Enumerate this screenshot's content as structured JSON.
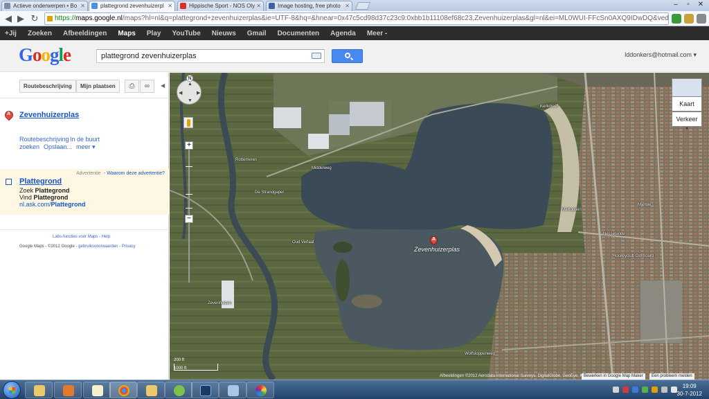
{
  "browser": {
    "tabs": [
      {
        "title": "Actieve onderwerpen • Bo",
        "favicon_color": "#7a8fa8"
      },
      {
        "title": "plattegrond zevenhuizerpl",
        "favicon_color": "#4a90e2",
        "active": true
      },
      {
        "title": "Hippische Sport - NOS Oly",
        "favicon_color": "#d6322b"
      },
      {
        "title": "Image hosting, free photo",
        "favicon_color": "#3b5fa8"
      }
    ],
    "url_scheme": "https://",
    "url_host": "maps.google.nl",
    "url_rest": "/maps?hl=nl&q=plattegrond+zevenhuizerplas&ie=UTF-8&hq=&hnear=0x47c5cd98d37c23c9:0xbb1b11108ef68c23,Zevenhuizerplas&gl=nl&ei=ML0WUI-FFcSn0AXQ9IDwDQ&ved=0CA"
  },
  "gbar": {
    "items": [
      "+Jij",
      "Zoeken",
      "Afbeeldingen",
      "Maps",
      "Play",
      "YouTube",
      "Nieuws",
      "Gmail",
      "Documenten",
      "Agenda",
      "Meer -"
    ],
    "active_index": 3
  },
  "header": {
    "logo": "Google",
    "search_value": "plattegrond zevenhuizerplas",
    "account": "lddonkers@hotmail.com"
  },
  "panel": {
    "buttons": {
      "directions": "Routebeschrijving",
      "my_places": "Mijn plaatsen"
    },
    "result": {
      "pin_letter": "A",
      "title": "Zevenhuizerplas",
      "links": [
        "Routebeschrijving",
        "In de buurt",
        "zoeken",
        "Opslaan...",
        "meer"
      ]
    },
    "ad": {
      "label": "Advertentie",
      "why": "Waarom deze advertentie?",
      "title": "Plattegrond",
      "line1_prefix": "Zoek ",
      "line1_bold": "Plattegrond",
      "line2_prefix": "Vind ",
      "line2_bold": "Plattegrond",
      "url_prefix": "nl.ask.com/",
      "url_bold": "Plattegrond"
    },
    "footer": {
      "labs": "Labs-functies voor Maps - Help",
      "copyright": "Google Maps - ©2012 Google - ",
      "terms": "gebruiksvoorwaarden",
      "separator": " - ",
      "privacy": "Privacy"
    }
  },
  "map": {
    "place_label": "Zevenhuizerplas",
    "pin_letter": "A",
    "type_buttons": {
      "map": "Kaart",
      "traffic": "Verkeer"
    },
    "scale": {
      "upper": "200 ft",
      "lower": "1000 ft"
    },
    "copyright": "Afbeeldingen ©2012 Aerodata International Surveys, DigitalGlobe, GeoEye, Kaartgegevens ©2012 Google",
    "report_buttons": {
      "edit": "Bewerken in Google Map Maker",
      "report": "Een probleem melden"
    },
    "labels": [
      "Rottemeren",
      "De Strandgaper",
      "Oud Verlaat",
      "Wolfsloppenweg",
      "Nesselande",
      "Hockeyclub Ommoord",
      "Zevenhuizen",
      "Middelweg",
      "Marlow",
      "Mailtoplein",
      "Kerkdreef"
    ]
  },
  "taskbar": {
    "time": "19:09",
    "date": "30-7-2012"
  }
}
